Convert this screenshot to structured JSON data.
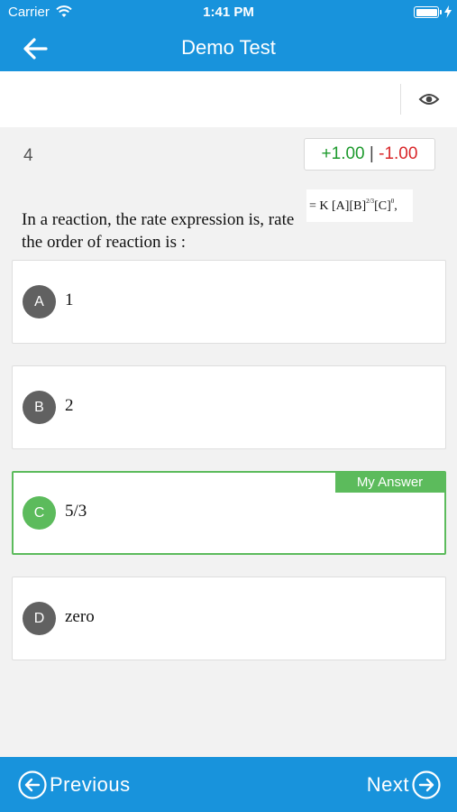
{
  "status_bar": {
    "carrier": "Carrier",
    "time": "1:41 PM",
    "wifi_icon": "wifi-icon",
    "battery_icon": "battery-icon",
    "charging_icon": "charging-bolt-icon"
  },
  "nav": {
    "title": "Demo Test",
    "back_icon": "arrow-left-icon"
  },
  "toolbar": {
    "eye_icon": "eye-icon"
  },
  "question": {
    "number": "4",
    "marks_positive": "+1.00",
    "marks_separator": "|",
    "marks_negative": "-1.00",
    "text_line1": "In a reaction, the rate expression is, rate",
    "text_line2": "the order of reaction is :",
    "formula_main": "= K [A][B]",
    "formula_exp1": "2/3",
    "formula_mid": "[C]",
    "formula_exp2": "0",
    "formula_end": ","
  },
  "options": [
    {
      "letter": "A",
      "text": "1"
    },
    {
      "letter": "B",
      "text": "2"
    },
    {
      "letter": "C",
      "text": "5/3",
      "selected": true,
      "tag": "My Answer"
    },
    {
      "letter": "D",
      "text": "zero"
    }
  ],
  "footer": {
    "previous_label": "Previous",
    "next_label": "Next"
  },
  "colors": {
    "primary": "#1893dc",
    "selected": "#5cbb5c",
    "positive": "#1d9a2d",
    "negative": "#d9272a"
  }
}
